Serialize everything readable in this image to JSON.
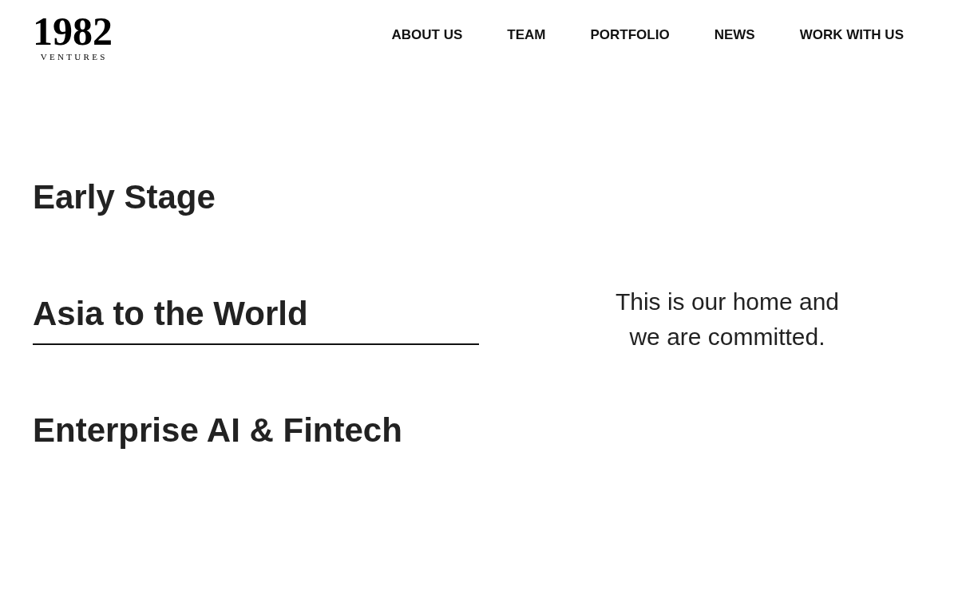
{
  "logo": {
    "numerals": "1982",
    "wordmark": "VENTURES"
  },
  "nav": [
    "ABOUT US",
    "TEAM",
    "PORTFOLIO",
    "NEWS",
    "WORK WITH US"
  ],
  "focus_areas": [
    {
      "title": "Early Stage",
      "selected": false
    },
    {
      "title": "Asia to the World",
      "selected": true
    },
    {
      "title": "Enterprise AI & Fintech",
      "selected": false
    }
  ],
  "description": "This is our home and we are committed."
}
